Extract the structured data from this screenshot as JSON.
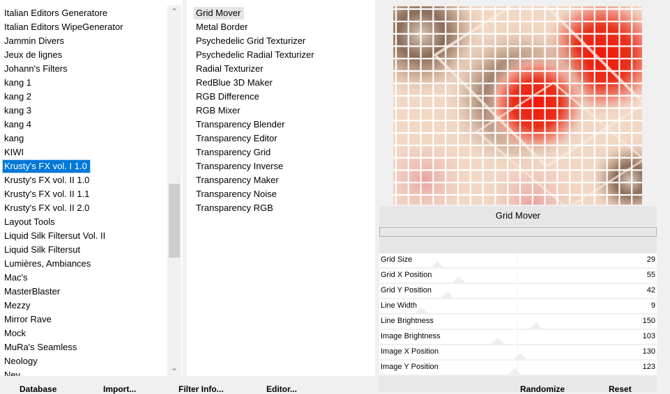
{
  "categories": {
    "items": [
      "Italian Editors Generatore",
      "Italian Editors WipeGenerator",
      "Jammin Divers",
      "Jeux de lignes",
      "Johann's Filters",
      "kang 1",
      "kang 2",
      "kang 3",
      "kang 4",
      "kang",
      "KIWI",
      "Krusty's FX vol. I 1.0",
      "Krusty's FX vol. II 1.0",
      "Krusty's FX vol. II 1.1",
      "Krusty's FX vol. II 2.0",
      "Layout Tools",
      "Liquid Silk Filtersut Vol. II",
      "Liquid Silk Filtersut",
      "Lumières, Ambiances",
      "Mac's",
      "MasterBlaster",
      "Mezzy",
      "Mirror Rave",
      "Mock",
      "MuRa's Seamless",
      "Neology",
      "Nev"
    ],
    "selected_index": 11
  },
  "filters": {
    "items": [
      "Grid Mover",
      "Metal Border",
      "Psychedelic Grid Texturizer",
      "Psychedelic Radial Texturizer",
      "Radial Texturizer",
      "RedBlue 3D Maker",
      "RGB Difference",
      "RGB Mixer",
      "Transparency Blender",
      "Transparency Editor",
      "Transparency Grid",
      "Transparency Inverse",
      "Transparency Maker",
      "Transparency Noise",
      "Transparency RGB"
    ],
    "selected_index": 0
  },
  "preview": {
    "title": "Grid Mover"
  },
  "params": [
    {
      "label": "Grid Size",
      "value": "29",
      "level": 29
    },
    {
      "label": "Grid X Position",
      "value": "55",
      "level": 55
    },
    {
      "label": "Grid Y Position",
      "value": "42",
      "level": 42
    },
    {
      "label": "Line Width",
      "value": "9",
      "level": 9
    },
    {
      "label": "Line Brightness",
      "value": "150",
      "level": 150
    },
    {
      "label": "Image Brightness",
      "value": "103",
      "level": 103
    },
    {
      "label": "Image X Position",
      "value": "130",
      "level": 130
    },
    {
      "label": "Image Y Position",
      "value": "123",
      "level": 123
    }
  ],
  "param_max": 255,
  "buttons": {
    "database": "Database",
    "import": "Import...",
    "filter_info": "Filter Info...",
    "editor": "Editor...",
    "randomize": "Randomize",
    "reset": "Reset"
  },
  "colors": {
    "selection": "#0078d7",
    "grid_line": "#ffffff",
    "swirl_red": "#e8321c"
  }
}
